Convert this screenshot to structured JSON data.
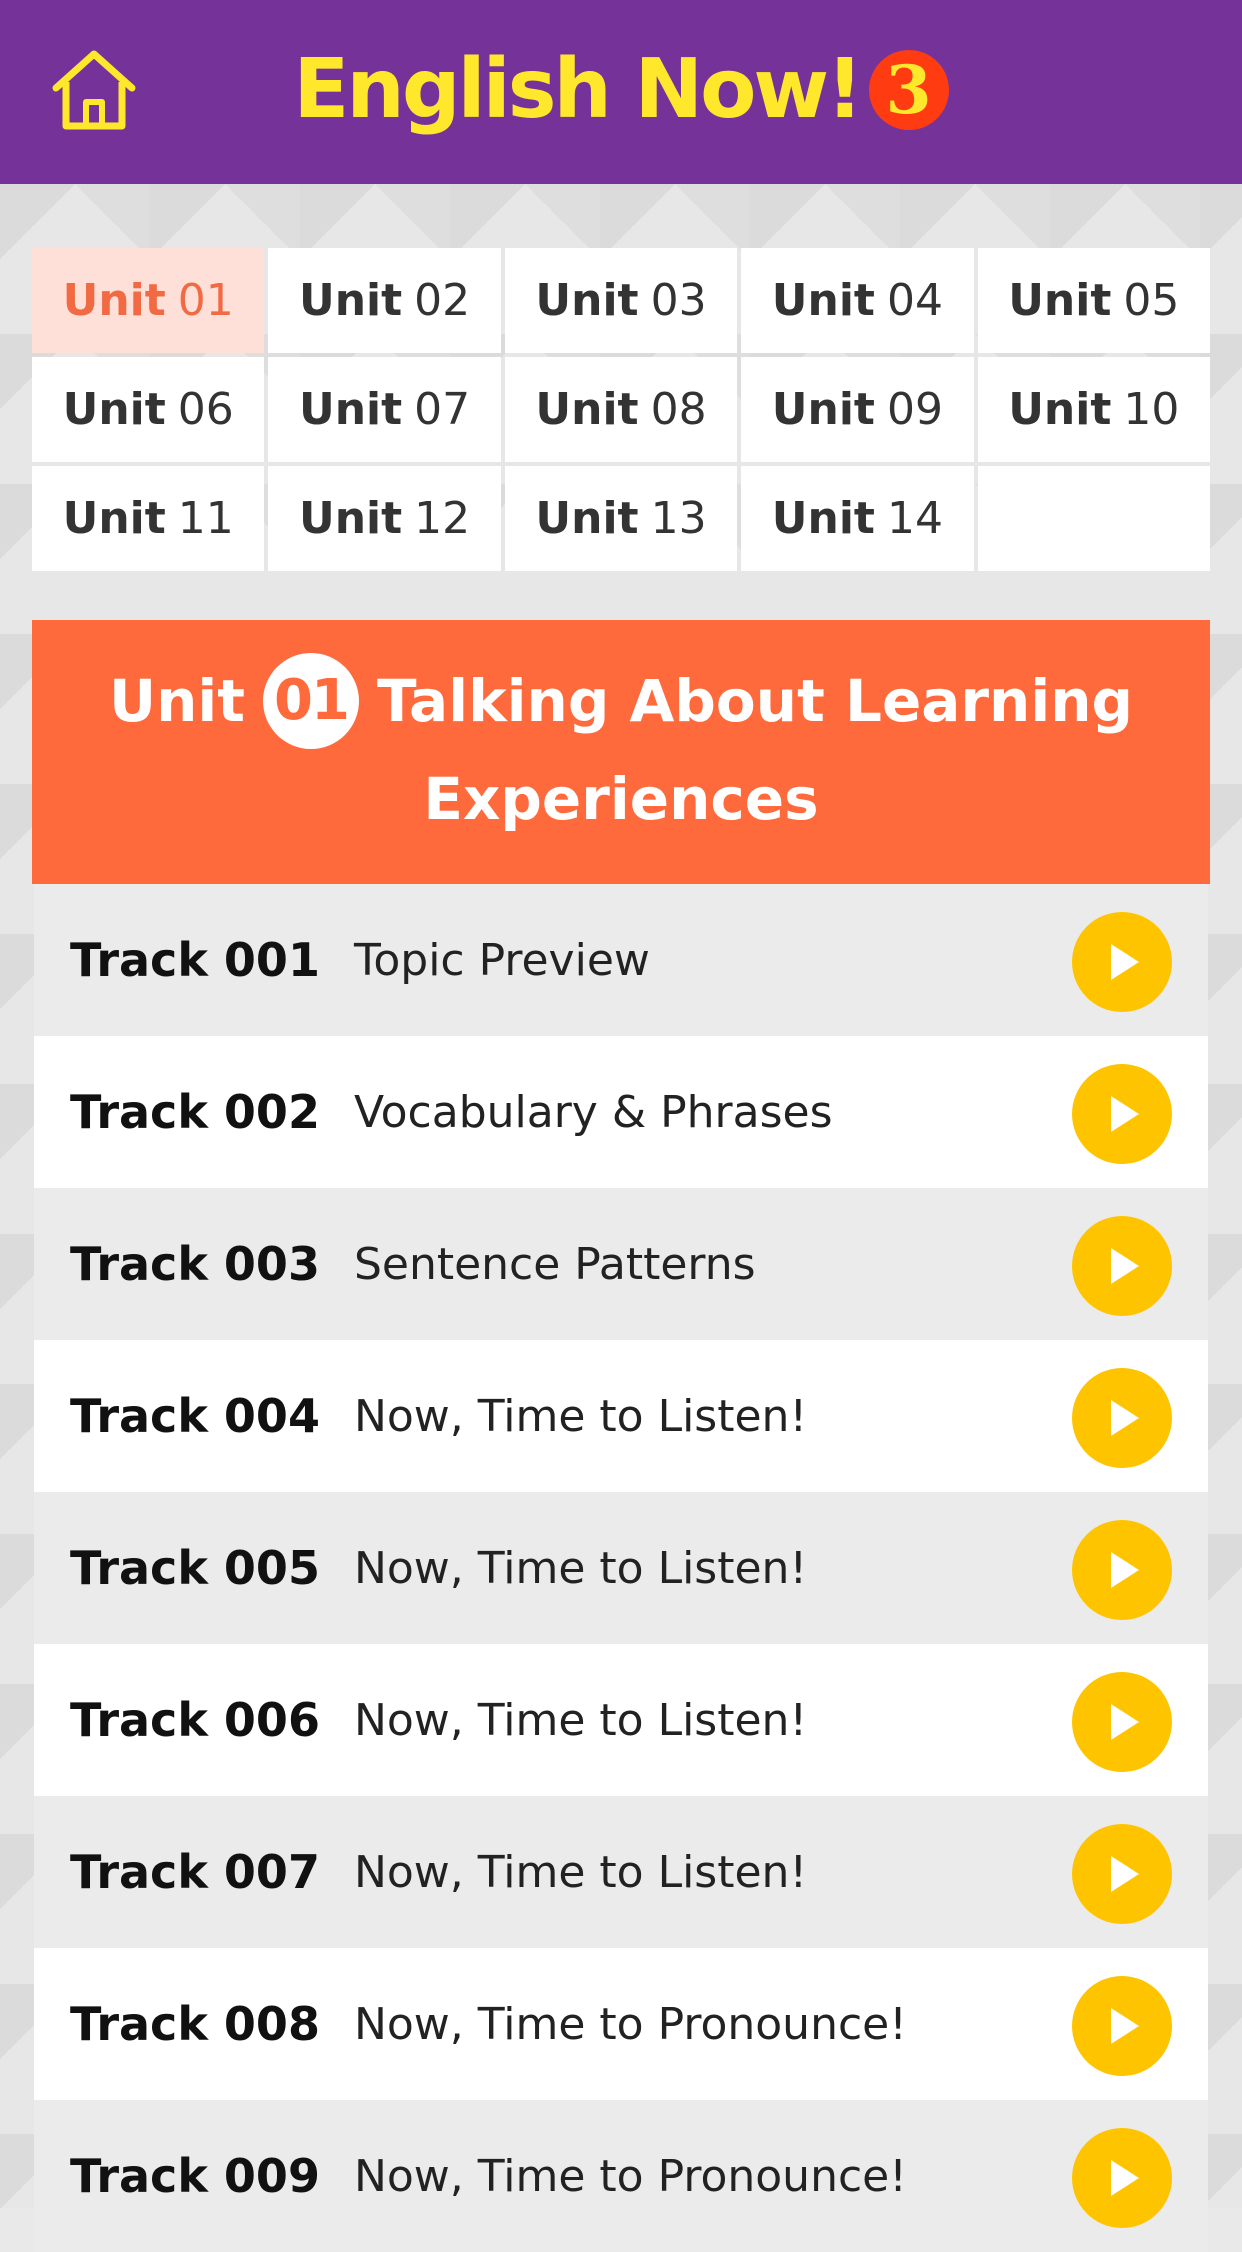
{
  "header": {
    "title": "English Now!",
    "badge": "3",
    "home_icon": "home-icon",
    "colors": {
      "bar": "#75339a",
      "title": "#ffe82b",
      "badge": "#ff3b12"
    }
  },
  "units": [
    {
      "label": "Unit",
      "num": "01",
      "active": true
    },
    {
      "label": "Unit",
      "num": "02",
      "active": false
    },
    {
      "label": "Unit",
      "num": "03",
      "active": false
    },
    {
      "label": "Unit",
      "num": "04",
      "active": false
    },
    {
      "label": "Unit",
      "num": "05",
      "active": false
    },
    {
      "label": "Unit",
      "num": "06",
      "active": false
    },
    {
      "label": "Unit",
      "num": "07",
      "active": false
    },
    {
      "label": "Unit",
      "num": "08",
      "active": false
    },
    {
      "label": "Unit",
      "num": "09",
      "active": false
    },
    {
      "label": "Unit",
      "num": "10",
      "active": false
    },
    {
      "label": "Unit",
      "num": "11",
      "active": false
    },
    {
      "label": "Unit",
      "num": "12",
      "active": false
    },
    {
      "label": "Unit",
      "num": "13",
      "active": false
    },
    {
      "label": "Unit",
      "num": "14",
      "active": false
    }
  ],
  "banner": {
    "unit_word": "Unit",
    "unit_num": "01",
    "title_line1": "Talking About Learning",
    "title_line2": "Experiences",
    "color": "#ff6a3d"
  },
  "tracks": [
    {
      "num": "Track 001",
      "title": "Topic Preview"
    },
    {
      "num": "Track 002",
      "title": "Vocabulary & Phrases"
    },
    {
      "num": "Track 003",
      "title": "Sentence Patterns"
    },
    {
      "num": "Track 004",
      "title": "Now, Time to Listen!"
    },
    {
      "num": "Track 005",
      "title": "Now, Time to Listen!"
    },
    {
      "num": "Track 006",
      "title": "Now, Time to Listen!"
    },
    {
      "num": "Track 007",
      "title": "Now, Time to Listen!"
    },
    {
      "num": "Track 008",
      "title": "Now, Time to Pronounce!"
    },
    {
      "num": "Track 009",
      "title": "Now, Time to Pronounce!"
    }
  ],
  "play_icon": "play-icon",
  "play_color": "#ffc400"
}
